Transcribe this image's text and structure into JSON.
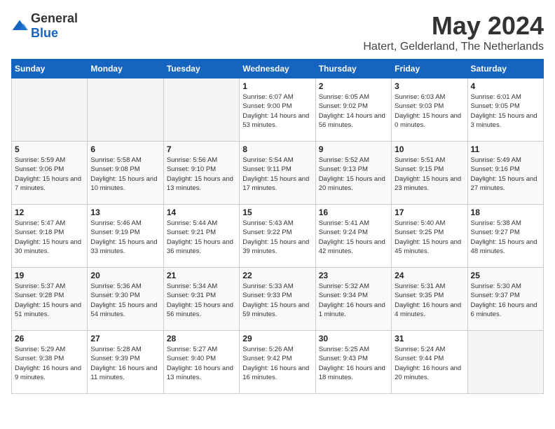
{
  "header": {
    "logo_general": "General",
    "logo_blue": "Blue",
    "title": "May 2024",
    "subtitle": "Hatert, Gelderland, The Netherlands"
  },
  "weekdays": [
    "Sunday",
    "Monday",
    "Tuesday",
    "Wednesday",
    "Thursday",
    "Friday",
    "Saturday"
  ],
  "weeks": [
    [
      {
        "day": "",
        "info": ""
      },
      {
        "day": "",
        "info": ""
      },
      {
        "day": "",
        "info": ""
      },
      {
        "day": "1",
        "info": "Sunrise: 6:07 AM\nSunset: 9:00 PM\nDaylight: 14 hours and 53 minutes."
      },
      {
        "day": "2",
        "info": "Sunrise: 6:05 AM\nSunset: 9:02 PM\nDaylight: 14 hours and 56 minutes."
      },
      {
        "day": "3",
        "info": "Sunrise: 6:03 AM\nSunset: 9:03 PM\nDaylight: 15 hours and 0 minutes."
      },
      {
        "day": "4",
        "info": "Sunrise: 6:01 AM\nSunset: 9:05 PM\nDaylight: 15 hours and 3 minutes."
      }
    ],
    [
      {
        "day": "5",
        "info": "Sunrise: 5:59 AM\nSunset: 9:06 PM\nDaylight: 15 hours and 7 minutes."
      },
      {
        "day": "6",
        "info": "Sunrise: 5:58 AM\nSunset: 9:08 PM\nDaylight: 15 hours and 10 minutes."
      },
      {
        "day": "7",
        "info": "Sunrise: 5:56 AM\nSunset: 9:10 PM\nDaylight: 15 hours and 13 minutes."
      },
      {
        "day": "8",
        "info": "Sunrise: 5:54 AM\nSunset: 9:11 PM\nDaylight: 15 hours and 17 minutes."
      },
      {
        "day": "9",
        "info": "Sunrise: 5:52 AM\nSunset: 9:13 PM\nDaylight: 15 hours and 20 minutes."
      },
      {
        "day": "10",
        "info": "Sunrise: 5:51 AM\nSunset: 9:15 PM\nDaylight: 15 hours and 23 minutes."
      },
      {
        "day": "11",
        "info": "Sunrise: 5:49 AM\nSunset: 9:16 PM\nDaylight: 15 hours and 27 minutes."
      }
    ],
    [
      {
        "day": "12",
        "info": "Sunrise: 5:47 AM\nSunset: 9:18 PM\nDaylight: 15 hours and 30 minutes."
      },
      {
        "day": "13",
        "info": "Sunrise: 5:46 AM\nSunset: 9:19 PM\nDaylight: 15 hours and 33 minutes."
      },
      {
        "day": "14",
        "info": "Sunrise: 5:44 AM\nSunset: 9:21 PM\nDaylight: 15 hours and 36 minutes."
      },
      {
        "day": "15",
        "info": "Sunrise: 5:43 AM\nSunset: 9:22 PM\nDaylight: 15 hours and 39 minutes."
      },
      {
        "day": "16",
        "info": "Sunrise: 5:41 AM\nSunset: 9:24 PM\nDaylight: 15 hours and 42 minutes."
      },
      {
        "day": "17",
        "info": "Sunrise: 5:40 AM\nSunset: 9:25 PM\nDaylight: 15 hours and 45 minutes."
      },
      {
        "day": "18",
        "info": "Sunrise: 5:38 AM\nSunset: 9:27 PM\nDaylight: 15 hours and 48 minutes."
      }
    ],
    [
      {
        "day": "19",
        "info": "Sunrise: 5:37 AM\nSunset: 9:28 PM\nDaylight: 15 hours and 51 minutes."
      },
      {
        "day": "20",
        "info": "Sunrise: 5:36 AM\nSunset: 9:30 PM\nDaylight: 15 hours and 54 minutes."
      },
      {
        "day": "21",
        "info": "Sunrise: 5:34 AM\nSunset: 9:31 PM\nDaylight: 15 hours and 56 minutes."
      },
      {
        "day": "22",
        "info": "Sunrise: 5:33 AM\nSunset: 9:33 PM\nDaylight: 15 hours and 59 minutes."
      },
      {
        "day": "23",
        "info": "Sunrise: 5:32 AM\nSunset: 9:34 PM\nDaylight: 16 hours and 1 minute."
      },
      {
        "day": "24",
        "info": "Sunrise: 5:31 AM\nSunset: 9:35 PM\nDaylight: 16 hours and 4 minutes."
      },
      {
        "day": "25",
        "info": "Sunrise: 5:30 AM\nSunset: 9:37 PM\nDaylight: 16 hours and 6 minutes."
      }
    ],
    [
      {
        "day": "26",
        "info": "Sunrise: 5:29 AM\nSunset: 9:38 PM\nDaylight: 16 hours and 9 minutes."
      },
      {
        "day": "27",
        "info": "Sunrise: 5:28 AM\nSunset: 9:39 PM\nDaylight: 16 hours and 11 minutes."
      },
      {
        "day": "28",
        "info": "Sunrise: 5:27 AM\nSunset: 9:40 PM\nDaylight: 16 hours and 13 minutes."
      },
      {
        "day": "29",
        "info": "Sunrise: 5:26 AM\nSunset: 9:42 PM\nDaylight: 16 hours and 16 minutes."
      },
      {
        "day": "30",
        "info": "Sunrise: 5:25 AM\nSunset: 9:43 PM\nDaylight: 16 hours and 18 minutes."
      },
      {
        "day": "31",
        "info": "Sunrise: 5:24 AM\nSunset: 9:44 PM\nDaylight: 16 hours and 20 minutes."
      },
      {
        "day": "",
        "info": ""
      }
    ]
  ]
}
